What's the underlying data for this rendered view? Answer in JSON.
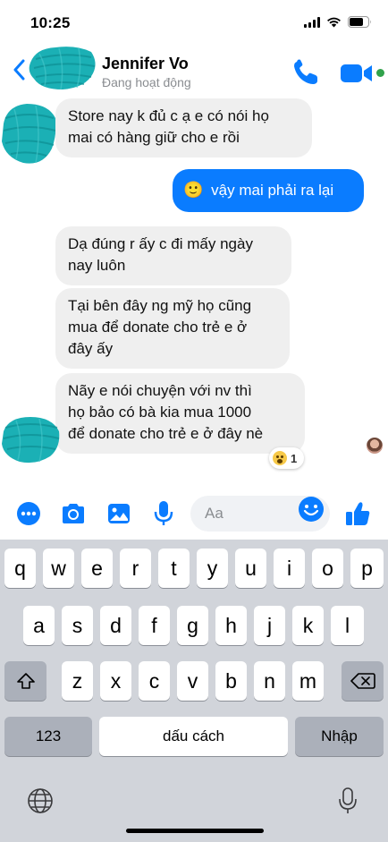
{
  "status_bar": {
    "time": "10:25"
  },
  "header": {
    "contact_name": "Jennifer Vo",
    "contact_status": "Đang hoạt động",
    "icons": {
      "back": "chevron-left-icon",
      "call": "phone-icon",
      "video": "video-camera-icon"
    },
    "accent_color": "#0a7cff",
    "online_color": "#31a24c"
  },
  "messages": [
    {
      "direction": "incoming",
      "lines": [
        "Store nay k đủ c ạ e có nói họ",
        "mai có hàng giữ cho e rồi"
      ]
    },
    {
      "direction": "outgoing",
      "emoji": "🙂",
      "text": "vậy mai phải ra lại"
    },
    {
      "direction": "incoming",
      "lines": [
        "Dạ đúng r ấy c đi mấy ngày",
        "nay luôn"
      ]
    },
    {
      "direction": "incoming",
      "lines": [
        "Tại bên đây ng mỹ họ cũng",
        "mua để donate cho trẻ e ở",
        "đây ấy"
      ]
    },
    {
      "direction": "incoming",
      "lines": [
        "Nãy e nói chuyện với nv thì",
        "họ bảo có bà kia mua 1000",
        "để donate cho trẻ e ở đây nè"
      ],
      "reaction": {
        "emoji": "wow-face",
        "count": "1"
      }
    }
  ],
  "composer": {
    "placeholder": "Aa",
    "icons": [
      "more-icon",
      "camera-icon",
      "gallery-icon",
      "microphone-icon",
      "emoji-icon",
      "thumbs-up-icon"
    ]
  },
  "keyboard": {
    "row1": [
      "q",
      "w",
      "e",
      "r",
      "t",
      "y",
      "u",
      "i",
      "o",
      "p"
    ],
    "row2": [
      "a",
      "s",
      "d",
      "f",
      "g",
      "h",
      "j",
      "k",
      "l"
    ],
    "row3": [
      "z",
      "x",
      "c",
      "v",
      "b",
      "n",
      "m"
    ],
    "numbers_key": "123",
    "space_key": "dấu cách",
    "return_key": "Nhập",
    "icons": {
      "shift": "shift-icon",
      "delete": "backspace-icon",
      "globe": "globe-icon",
      "dictation": "microphone-icon"
    }
  }
}
